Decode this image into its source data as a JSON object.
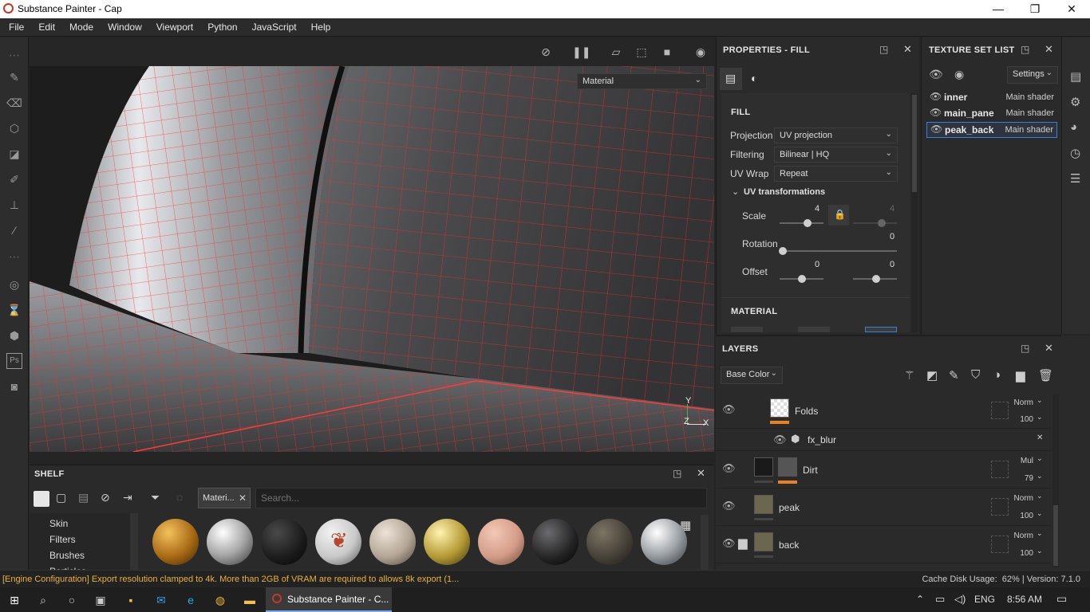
{
  "window": {
    "title": "Substance Painter - Cap",
    "minimize": "—",
    "maximize": "❐",
    "close": "✕"
  },
  "menu": [
    "File",
    "Edit",
    "Mode",
    "Window",
    "Viewport",
    "Python",
    "JavaScript",
    "Help"
  ],
  "viewport": {
    "view_mode": "Material",
    "axis_y": "Y",
    "axis_x": "X",
    "axis_z": "Z"
  },
  "properties": {
    "title": "PROPERTIES - FILL",
    "section": "FILL",
    "projection_label": "Projection",
    "projection_value": "UV projection",
    "filtering_label": "Filtering",
    "filtering_value": "Bilinear | HQ",
    "uvwrap_label": "UV Wrap",
    "uvwrap_value": "Repeat",
    "uvtrans_label": "UV transformations",
    "scale_label": "Scale",
    "scale_value": "4",
    "scale_value2": "4",
    "rotation_label": "Rotation",
    "rotation_value": "0",
    "offset_label": "Offset",
    "offset_value": "0",
    "offset_value2": "0",
    "material_section": "MATERIAL"
  },
  "texture_set_list": {
    "title": "TEXTURE SET LIST",
    "settings": "Settings",
    "items": [
      {
        "name": "inner",
        "shader": "Main shader"
      },
      {
        "name": "main_pane",
        "shader": "Main shader"
      },
      {
        "name": "peak_back",
        "shader": "Main shader"
      }
    ]
  },
  "layers": {
    "title": "LAYERS",
    "channel": "Base Color",
    "rows": [
      {
        "name": "Folds",
        "blend": "Norm",
        "opacity": "100"
      },
      {
        "name": "fx_blur"
      },
      {
        "name": "Dirt",
        "blend": "Mul",
        "opacity": "79"
      },
      {
        "name": "peak",
        "blend": "Norm",
        "opacity": "100"
      },
      {
        "name": "back",
        "blend": "Norm",
        "opacity": "100"
      }
    ]
  },
  "shelf": {
    "title": "SHELF",
    "filter_tag": "Materi...",
    "search_placeholder": "Search...",
    "categories": [
      "Skin",
      "Filters",
      "Brushes",
      "Particles"
    ]
  },
  "status": {
    "message": "[Engine Configuration] Export resolution clamped to 4k. More than 2GB of VRAM are required to allows 8k export (1...",
    "cache": "Cache Disk Usage:  62% | Version: 7.1.0"
  },
  "taskbar": {
    "app": "Substance Painter - C...",
    "lang": "ENG",
    "time": "8:56 AM"
  },
  "colors": {
    "accent": "#e8821e",
    "wire": "#ff2a2a",
    "status_warn": "#e8b23a"
  }
}
